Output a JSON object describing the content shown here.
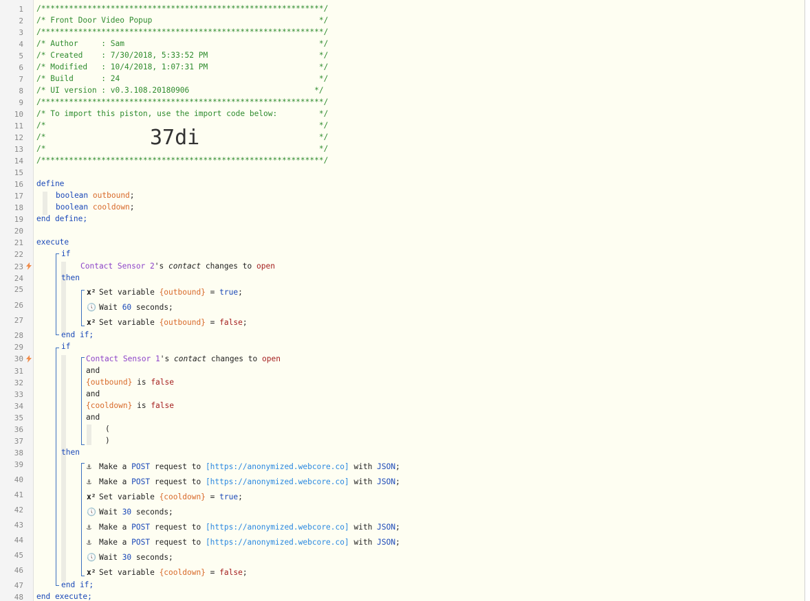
{
  "editor": {
    "line_numbers": [
      "1",
      "2",
      "3",
      "4",
      "5",
      "6",
      "7",
      "8",
      "9",
      "10",
      "11",
      "12",
      "13",
      "14",
      "15",
      "16",
      "17",
      "18",
      "19",
      "20",
      "21",
      "22",
      "23",
      "24",
      "25",
      "26",
      "27",
      "28",
      "29",
      "30",
      "31",
      "32",
      "33",
      "34",
      "35",
      "36",
      "37",
      "38",
      "39",
      "40",
      "41",
      "42",
      "43",
      "44",
      "45",
      "46",
      "47",
      "48"
    ],
    "header": {
      "border": "/*************************************************************/",
      "title": "/* Front Door Video Popup                                    */",
      "author": "/* Author     : Sam                                          */",
      "created": "/* Created    : 7/30/2018, 5:33:52 PM                        */",
      "modified": "/* Modified   : 10/4/2018, 1:07:31 PM                        */",
      "build": "/* Build      : 24                                           */",
      "ui_version": "/* UI version : v0.3.108.20180906                           */",
      "import_note": "/* To import this piston, use the import code below:         */",
      "blank": "/*                                                           */",
      "blank_prefix": "/*",
      "blank_suffix": "*/",
      "import_code": "37di"
    },
    "kw": {
      "define": "define",
      "boolean": "boolean",
      "end_define": "end define;",
      "execute": "execute",
      "if": "if",
      "then": "then",
      "end_if": "end if;",
      "and": "and",
      "end_execute": "end execute;",
      "set_variable": "Set variable ",
      "wait": "Wait ",
      "seconds": " seconds;",
      "make_a": "Make a ",
      "post": "POST",
      "request_to": " request to ",
      "with": " with ",
      "json": "JSON",
      "semicolon": ";",
      "eq": " = ",
      "is": " is ",
      "s_possessive": "'s ",
      "changes_to": " changes to ",
      "open_paren": "(",
      "close_paren": ")"
    },
    "vars": {
      "outbound": "outbound",
      "cooldown": "cooldown",
      "outbound_ref": "{outbound}",
      "cooldown_ref": "{cooldown}"
    },
    "values": {
      "true": "true",
      "false": "false",
      "open": "open",
      "wait1": "60",
      "wait2": "30",
      "url": "[https://anonymized.webcore.co]"
    },
    "devices": {
      "sensor2": "Contact Sensor 2",
      "sensor1": "Contact Sensor 1",
      "attr": "contact"
    },
    "icons": {
      "variable": "variable-x2-icon",
      "clock": "clock-icon",
      "anchor": "anchor-icon",
      "trigger": "lightning-trigger-icon",
      "x2_text": "x²",
      "clock_glyph": "🕔",
      "anchor_glyph": "⚓"
    },
    "colors": {
      "comment": "#2e8b2e",
      "keyword": "#1a48b8",
      "variable": "#d86a2a",
      "device": "#8d44c9",
      "value": "#a52020",
      "url": "#2a88e0",
      "trigger": "#f08c4a"
    }
  }
}
